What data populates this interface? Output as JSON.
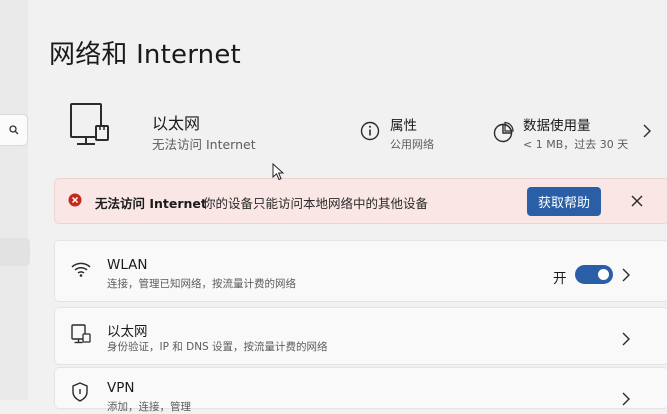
{
  "page": {
    "title": "网络和 Internet"
  },
  "header": {
    "name": "以太网",
    "status": "无法访问 Internet",
    "properties": {
      "label": "属性",
      "value": "公用网络"
    },
    "data_usage": {
      "label": "数据使用量",
      "value": "< 1 MB，过去 30 天"
    }
  },
  "banner": {
    "title": "无法访问 Internet",
    "message": "你的设备只能访问本地网络中的其他设备",
    "button": "获取帮助"
  },
  "cards": [
    {
      "title": "WLAN",
      "desc": "连接，管理已知网络，按流量计费的网络",
      "toggle_label": "开",
      "toggle_on": true
    },
    {
      "title": "以太网",
      "desc": "身份验证，IP 和 DNS 设置，按流量计费的网络"
    },
    {
      "title": "VPN",
      "desc": "添加，连接，管理"
    }
  ],
  "icons": {
    "search": "search-icon",
    "ethernet": "ethernet-monitor-icon",
    "info": "info-icon",
    "data_usage": "data-usage-pie-icon",
    "error": "error-icon",
    "close": "close-icon",
    "wifi": "wifi-icon",
    "vpn": "shield-icon",
    "chevron": "chevron-right-icon"
  },
  "colors": {
    "accent": "#2a5fa7",
    "error": "#c42b1c",
    "banner_bg": "#f9e6e5"
  }
}
